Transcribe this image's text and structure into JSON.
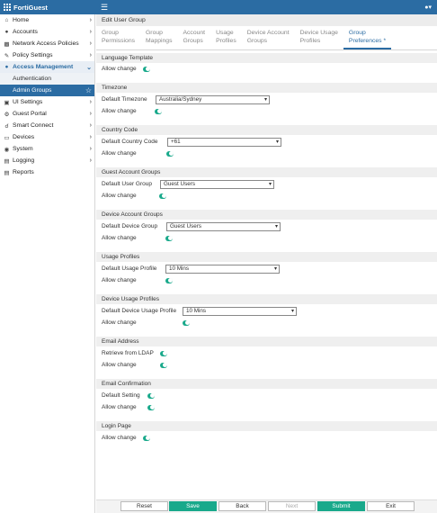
{
  "app": {
    "title": "FortiGuest",
    "user_icon": "user-icon"
  },
  "sidebar": {
    "items": [
      {
        "label": "Home",
        "icon": "home-icon"
      },
      {
        "label": "Accounts",
        "icon": "people-icon"
      },
      {
        "label": "Network Access Policies",
        "icon": "network-icon"
      },
      {
        "label": "Policy Settings",
        "icon": "edit-icon"
      },
      {
        "label": "Access Management",
        "icon": "users-icon"
      },
      {
        "label": "Authentication"
      },
      {
        "label": "Admin Groups"
      },
      {
        "label": "UI Settings",
        "icon": "monitor-icon"
      },
      {
        "label": "Guest Portal",
        "icon": "gear-icon"
      },
      {
        "label": "Smart Connect",
        "icon": "connect-icon"
      },
      {
        "label": "Devices",
        "icon": "laptop-icon"
      },
      {
        "label": "System",
        "icon": "globe-icon"
      },
      {
        "label": "Logging",
        "icon": "chart-icon"
      },
      {
        "label": "Reports",
        "icon": "report-icon"
      }
    ]
  },
  "main": {
    "header": "Edit User Group",
    "tabs": [
      {
        "line1": "Group",
        "line2": "Permissions"
      },
      {
        "line1": "Group",
        "line2": "Mappings"
      },
      {
        "line1": "Account",
        "line2": "Groups"
      },
      {
        "line1": "Usage",
        "line2": "Profiles"
      },
      {
        "line1": "Device Account",
        "line2": "Groups"
      },
      {
        "line1": "Device Usage",
        "line2": "Profiles"
      },
      {
        "line1": "Group",
        "line2": "Preferences *"
      }
    ]
  },
  "sections": {
    "language": {
      "title": "Language Template",
      "allow": "Allow change"
    },
    "timezone": {
      "title": "Timezone",
      "label": "Default Timezone",
      "value": "Australia/Sydney",
      "allow": "Allow change"
    },
    "country": {
      "title": "Country Code",
      "label": "Default Country Code",
      "value": "+61",
      "allow": "Allow change"
    },
    "guest_groups": {
      "title": "Guest Account Groups",
      "label": "Default User Group",
      "value": "Guest Users",
      "allow": "Allow change"
    },
    "device_groups": {
      "title": "Device Account Groups",
      "label": "Default Device Group",
      "value": "Guest Users",
      "allow": "Allow change"
    },
    "usage": {
      "title": "Usage Profiles",
      "label": "Default Usage Profile",
      "value": "10 Mins",
      "allow": "Allow change"
    },
    "device_usage": {
      "title": "Device Usage Profiles",
      "label": "Default Device Usage Profile",
      "value": "10 Mins",
      "allow": "Allow change"
    },
    "email": {
      "title": "Email Address",
      "retrieve": "Retrieve from LDAP",
      "allow": "Allow change"
    },
    "email_conf": {
      "title": "Email Confirmation",
      "default": "Default Setting",
      "allow": "Allow change"
    },
    "login": {
      "title": "Login Page",
      "allow": "Allow change"
    }
  },
  "footer": {
    "reset": "Reset",
    "save": "Save",
    "back": "Back",
    "next": "Next",
    "submit": "Submit",
    "exit": "Exit"
  },
  "colors": {
    "brand": "#2b6ca3",
    "toggle_on": "#19a98b",
    "primary_button": "#19a98b"
  }
}
